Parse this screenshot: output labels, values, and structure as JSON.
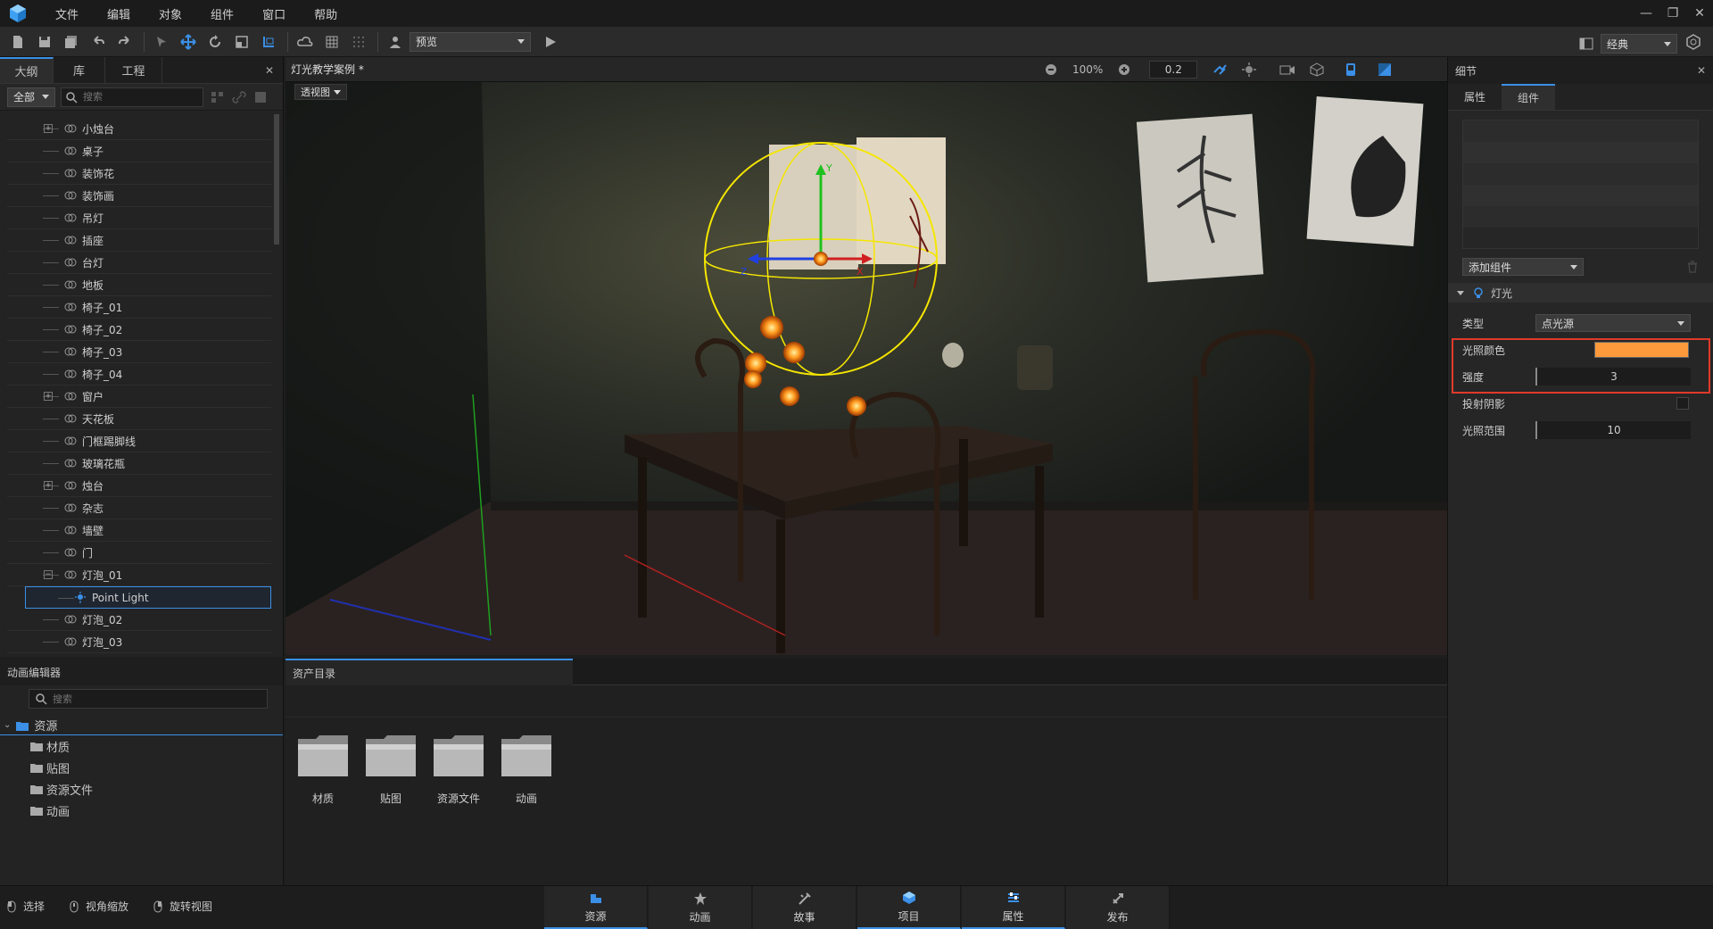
{
  "menu": {
    "items": [
      "文件",
      "编辑",
      "对象",
      "组件",
      "窗口",
      "帮助"
    ]
  },
  "toolbar": {
    "preview_label": "预览",
    "layout_label": "经典"
  },
  "outline": {
    "tabs": [
      "大纲",
      "库",
      "工程"
    ],
    "filter_label": "全部",
    "search_placeholder": "搜索",
    "items": [
      "小烛台",
      "桌子",
      "装饰花",
      "装饰画",
      "吊灯",
      "插座",
      "台灯",
      "地板",
      "椅子_01",
      "椅子_02",
      "椅子_03",
      "椅子_04",
      "窗户",
      "天花板",
      "门框踢脚线",
      "玻璃花瓶",
      "烛台",
      "杂志",
      "墙壁",
      "门",
      "灯泡_01",
      "Point Light",
      "灯泡_02",
      "灯泡_03"
    ]
  },
  "viewport": {
    "title": "灯光教学案例 *",
    "view_mode": "透视图",
    "zoom": "100%",
    "snap": "0.2",
    "axis_x": "X",
    "axis_y": "Y",
    "axis_z": "Z"
  },
  "details": {
    "title": "细节",
    "tabs": [
      "属性",
      "组件"
    ],
    "add_component": "添加组件",
    "section": "灯光",
    "props": {
      "type_label": "类型",
      "type_value": "点光源",
      "color_label": "光照颜色",
      "color_value": "#ff9a3c",
      "intensity_label": "强度",
      "intensity_value": "3",
      "shadow_label": "投射阴影",
      "range_label": "光照范围",
      "range_value": "10"
    }
  },
  "anim": {
    "title": "动画编辑器",
    "search_placeholder": "搜索",
    "root": "资源",
    "children": [
      "材质",
      "贴图",
      "资源文件",
      "动画"
    ]
  },
  "assets": {
    "tab": "资产目录",
    "folders": [
      "材质",
      "贴图",
      "资源文件",
      "动画"
    ]
  },
  "status": {
    "select": "选择",
    "zoom_view": "视角缩放",
    "rotate_view": "旋转视图"
  },
  "bottom_tabs": [
    "资源",
    "动画",
    "故事",
    "项目",
    "属性",
    "发布"
  ],
  "colors": {
    "accent": "#3b8fe6",
    "highlight": "#e03a2a",
    "light_color": "#ff9a3c"
  }
}
